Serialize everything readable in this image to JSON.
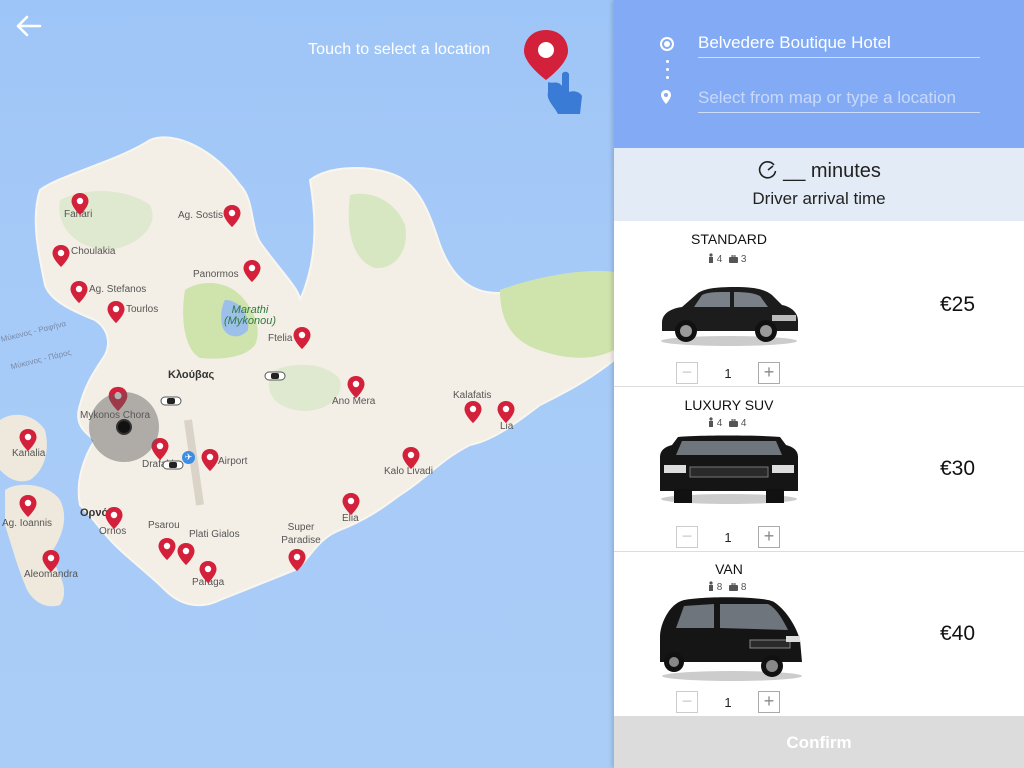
{
  "map": {
    "hint_text": "Touch to select a location",
    "places": [
      {
        "id": "fanari",
        "label": "Fanari"
      },
      {
        "id": "ag-sostis",
        "label": "Ag. Sostis"
      },
      {
        "id": "choulakia",
        "label": "Choulakia"
      },
      {
        "id": "panormos",
        "label": "Panormos"
      },
      {
        "id": "ag-stefanos",
        "label": "Ag. Stefanos"
      },
      {
        "id": "tourlos",
        "label": "Tourlos"
      },
      {
        "id": "marathi",
        "label": "Marathi (Mykonou)"
      },
      {
        "id": "ftelia",
        "label": "Ftelia"
      },
      {
        "id": "klouvas",
        "label": "Κλούβας"
      },
      {
        "id": "ano-mera",
        "label": "Ano Mera"
      },
      {
        "id": "kalafatis",
        "label": "Kalafatis"
      },
      {
        "id": "lia",
        "label": "Lia"
      },
      {
        "id": "mykonos-chora",
        "label": "Mykonos Chora"
      },
      {
        "id": "kanalia",
        "label": "Kanalia"
      },
      {
        "id": "drafaki",
        "label": "Drafaki"
      },
      {
        "id": "airport",
        "label": "Airport"
      },
      {
        "id": "kalo-livadi",
        "label": "Kalo Livadi"
      },
      {
        "id": "ag-ioannis",
        "label": "Ag. Ioannis"
      },
      {
        "id": "ornos-gr",
        "label": "Ορνός"
      },
      {
        "id": "ornos",
        "label": "Ornos"
      },
      {
        "id": "psarou",
        "label": "Psarou"
      },
      {
        "id": "plati-gialos",
        "label": "Plati Gialos"
      },
      {
        "id": "super-paradise",
        "label": "Super Paradise"
      },
      {
        "id": "elia",
        "label": "Elia"
      },
      {
        "id": "aleomandra",
        "label": "Aleomandra"
      },
      {
        "id": "paraga",
        "label": "Paraga"
      },
      {
        "id": "route-1",
        "label": "Μύκονος - Ραφήνα"
      },
      {
        "id": "route-2",
        "label": "Μύκονος - Πάρος"
      }
    ]
  },
  "route": {
    "origin_value": "Belvedere Boutique Hotel",
    "destination_placeholder": "Select from map or type a location"
  },
  "eta": {
    "minutes_text": "__ minutes",
    "subtitle": "Driver arrival time"
  },
  "vehicles": [
    {
      "name": "STANDARD",
      "passengers": "4",
      "luggage": "3",
      "price": "€25",
      "quantity": "1"
    },
    {
      "name": "LUXURY SUV",
      "passengers": "4",
      "luggage": "4",
      "price": "€30",
      "quantity": "1"
    },
    {
      "name": "VAN",
      "passengers": "8",
      "luggage": "8",
      "price": "€40",
      "quantity": "1"
    }
  ],
  "confirm_label": "Confirm",
  "colors": {
    "accent": "#83abf5",
    "pin": "#d3203b",
    "eta_bg": "#e3ecf6",
    "confirm_bg": "#dcdcdc"
  }
}
